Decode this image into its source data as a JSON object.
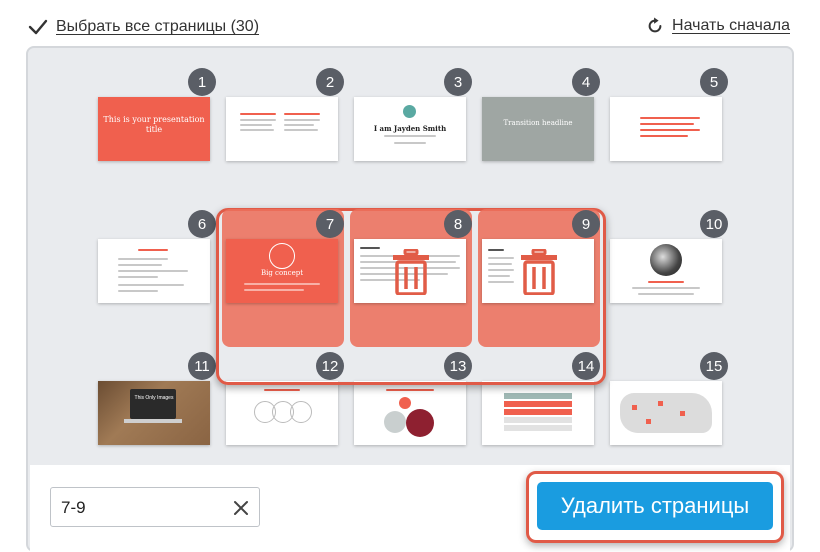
{
  "toolbar": {
    "select_all_label": "Выбрать все страницы (30)",
    "restart_label": "Начать сначала"
  },
  "pages": [
    {
      "number": "1",
      "title": "This is your presentation title",
      "style": "red"
    },
    {
      "number": "2",
      "style": "white"
    },
    {
      "number": "3",
      "title": "I am Jayden Smith",
      "style": "white"
    },
    {
      "number": "4",
      "title": "Transition headline",
      "style": "gray"
    },
    {
      "number": "5",
      "style": "white"
    },
    {
      "number": "6",
      "style": "white"
    },
    {
      "number": "7",
      "title": "Big concept",
      "style": "red",
      "selected": true
    },
    {
      "number": "8",
      "style": "white",
      "selected": true
    },
    {
      "number": "9",
      "style": "white",
      "selected": true
    },
    {
      "number": "10",
      "style": "white"
    },
    {
      "number": "11",
      "title": "This Only Images",
      "style": "photo"
    },
    {
      "number": "12",
      "style": "white"
    },
    {
      "number": "13",
      "style": "white"
    },
    {
      "number": "14",
      "style": "white"
    },
    {
      "number": "15",
      "style": "white"
    }
  ],
  "range_input": {
    "value": "7-9"
  },
  "delete_button": {
    "label": "Удалить страницы"
  },
  "colors": {
    "accent": "#1a9ce0",
    "selection": "#e05a47",
    "badge": "#5a5e66",
    "slide_red": "#f0604e"
  }
}
